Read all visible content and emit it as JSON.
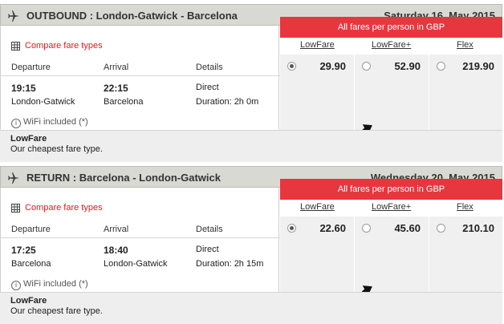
{
  "outbound": {
    "header_title": "OUTBOUND :  London-Gatwick - Barcelona",
    "date": "Saturday 16. May 2015",
    "compare": "Compare fare types",
    "columns": {
      "departure": "Departure",
      "arrival": "Arrival",
      "details": "Details"
    },
    "dep_time": "19:15",
    "dep_place": "London-Gatwick",
    "arr_time": "22:15",
    "arr_place": "Barcelona",
    "stops": "Direct",
    "duration": "Duration: 2h 0m",
    "wifi": "WiFi included (*)",
    "fares_banner": "All fares per person in GBP",
    "fare_types": [
      "LowFare",
      "LowFare+",
      "Flex"
    ],
    "prices": [
      "29.90",
      "52.90",
      "219.90"
    ],
    "selected_fare": 0,
    "footer_title": "LowFare",
    "footer_desc": "Our cheapest fare type."
  },
  "return": {
    "header_title": "RETURN :  Barcelona - London-Gatwick",
    "date": "Wednesday 20. May 2015",
    "compare": "Compare fare types",
    "columns": {
      "departure": "Departure",
      "arrival": "Arrival",
      "details": "Details"
    },
    "dep_time": "17:25",
    "dep_place": "Barcelona",
    "arr_time": "18:40",
    "arr_place": "London-Gatwick",
    "stops": "Direct",
    "duration": "Duration: 2h 15m",
    "wifi": "WiFi included (*)",
    "fares_banner": "All fares per person in GBP",
    "fare_types": [
      "LowFare",
      "LowFare+",
      "Flex"
    ],
    "prices": [
      "22.60",
      "45.60",
      "210.10"
    ],
    "selected_fare": 0,
    "footer_title": "LowFare",
    "footer_desc": "Our cheapest fare type."
  },
  "icons": {
    "plane": "plane-icon",
    "grid": "fare-table-icon",
    "info": "info-icon",
    "cursor": "curved-arrow-icon"
  },
  "colors": {
    "accent": "#e8363f",
    "link": "#e21a22",
    "header_bg": "#d9d9d4"
  }
}
